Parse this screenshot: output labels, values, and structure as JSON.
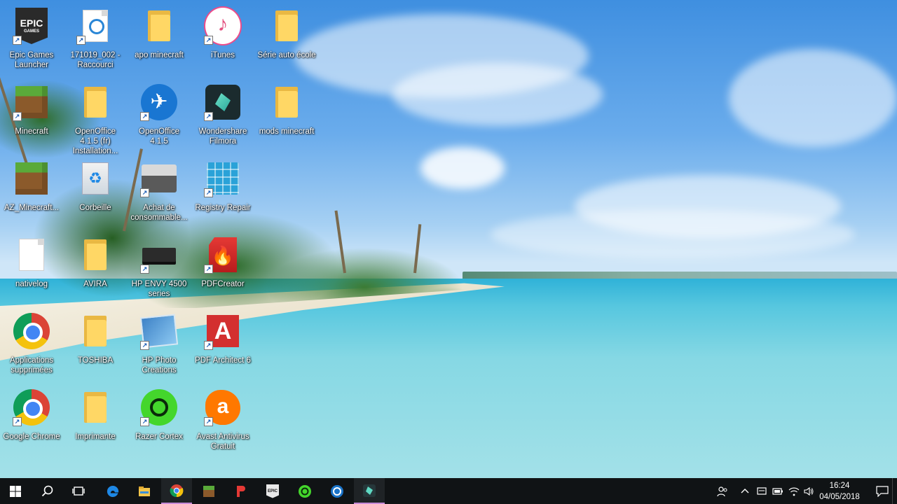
{
  "desktop": {
    "icons": [
      {
        "label": "Epic Games Launcher"
      },
      {
        "label": "171019_002 - Raccourci"
      },
      {
        "label": "apo minecraft"
      },
      {
        "label": "iTunes"
      },
      {
        "label": "Série auto école"
      },
      {
        "label": "Minecraft"
      },
      {
        "label": "OpenOffice 4.1.5 (fr) Installation..."
      },
      {
        "label": "OpenOffice 4.1.5"
      },
      {
        "label": "Wondershare Filmora"
      },
      {
        "label": "mods minecraft"
      },
      {
        "label": "AZ_Minecraft..."
      },
      {
        "label": "Corbeille"
      },
      {
        "label": "Achat de consommable..."
      },
      {
        "label": "Registry Repair"
      },
      {
        "label": "nativelog"
      },
      {
        "label": "AVIRA"
      },
      {
        "label": "HP ENVY 4500 series"
      },
      {
        "label": "PDFCreator"
      },
      {
        "label": "Applications supprimées"
      },
      {
        "label": "TOSHIBA"
      },
      {
        "label": "HP Photo Creations"
      },
      {
        "label": "PDF Architect 6"
      },
      {
        "label": "Google Chrome"
      },
      {
        "label": "Imprimante"
      },
      {
        "label": "Razer Cortex"
      },
      {
        "label": "Avast Antivirus Gratuit"
      }
    ],
    "icon_glyphs": {
      "epic_text": "EPIC",
      "epic_sub": "GAMES",
      "itunes": "♪",
      "pdf_architect": "A",
      "avast": "a"
    }
  },
  "taskbar": {
    "clock_time": "16:24",
    "clock_date": "04/05/2018",
    "epic_text": "EPIC",
    "pinned": [
      "start-icon",
      "search-icon",
      "task-view-icon",
      "edge-icon",
      "file-explorer-icon",
      "chrome-icon",
      "minecraft-icon",
      "pdf-architect-icon",
      "epic-games-icon",
      "razer-cortex-icon",
      "hp-icon",
      "filmora-icon"
    ],
    "tray": [
      "people-icon",
      "chevron-up-icon",
      "message-icon",
      "battery-icon",
      "wifi-icon",
      "volume-icon",
      "notification-icon"
    ]
  }
}
